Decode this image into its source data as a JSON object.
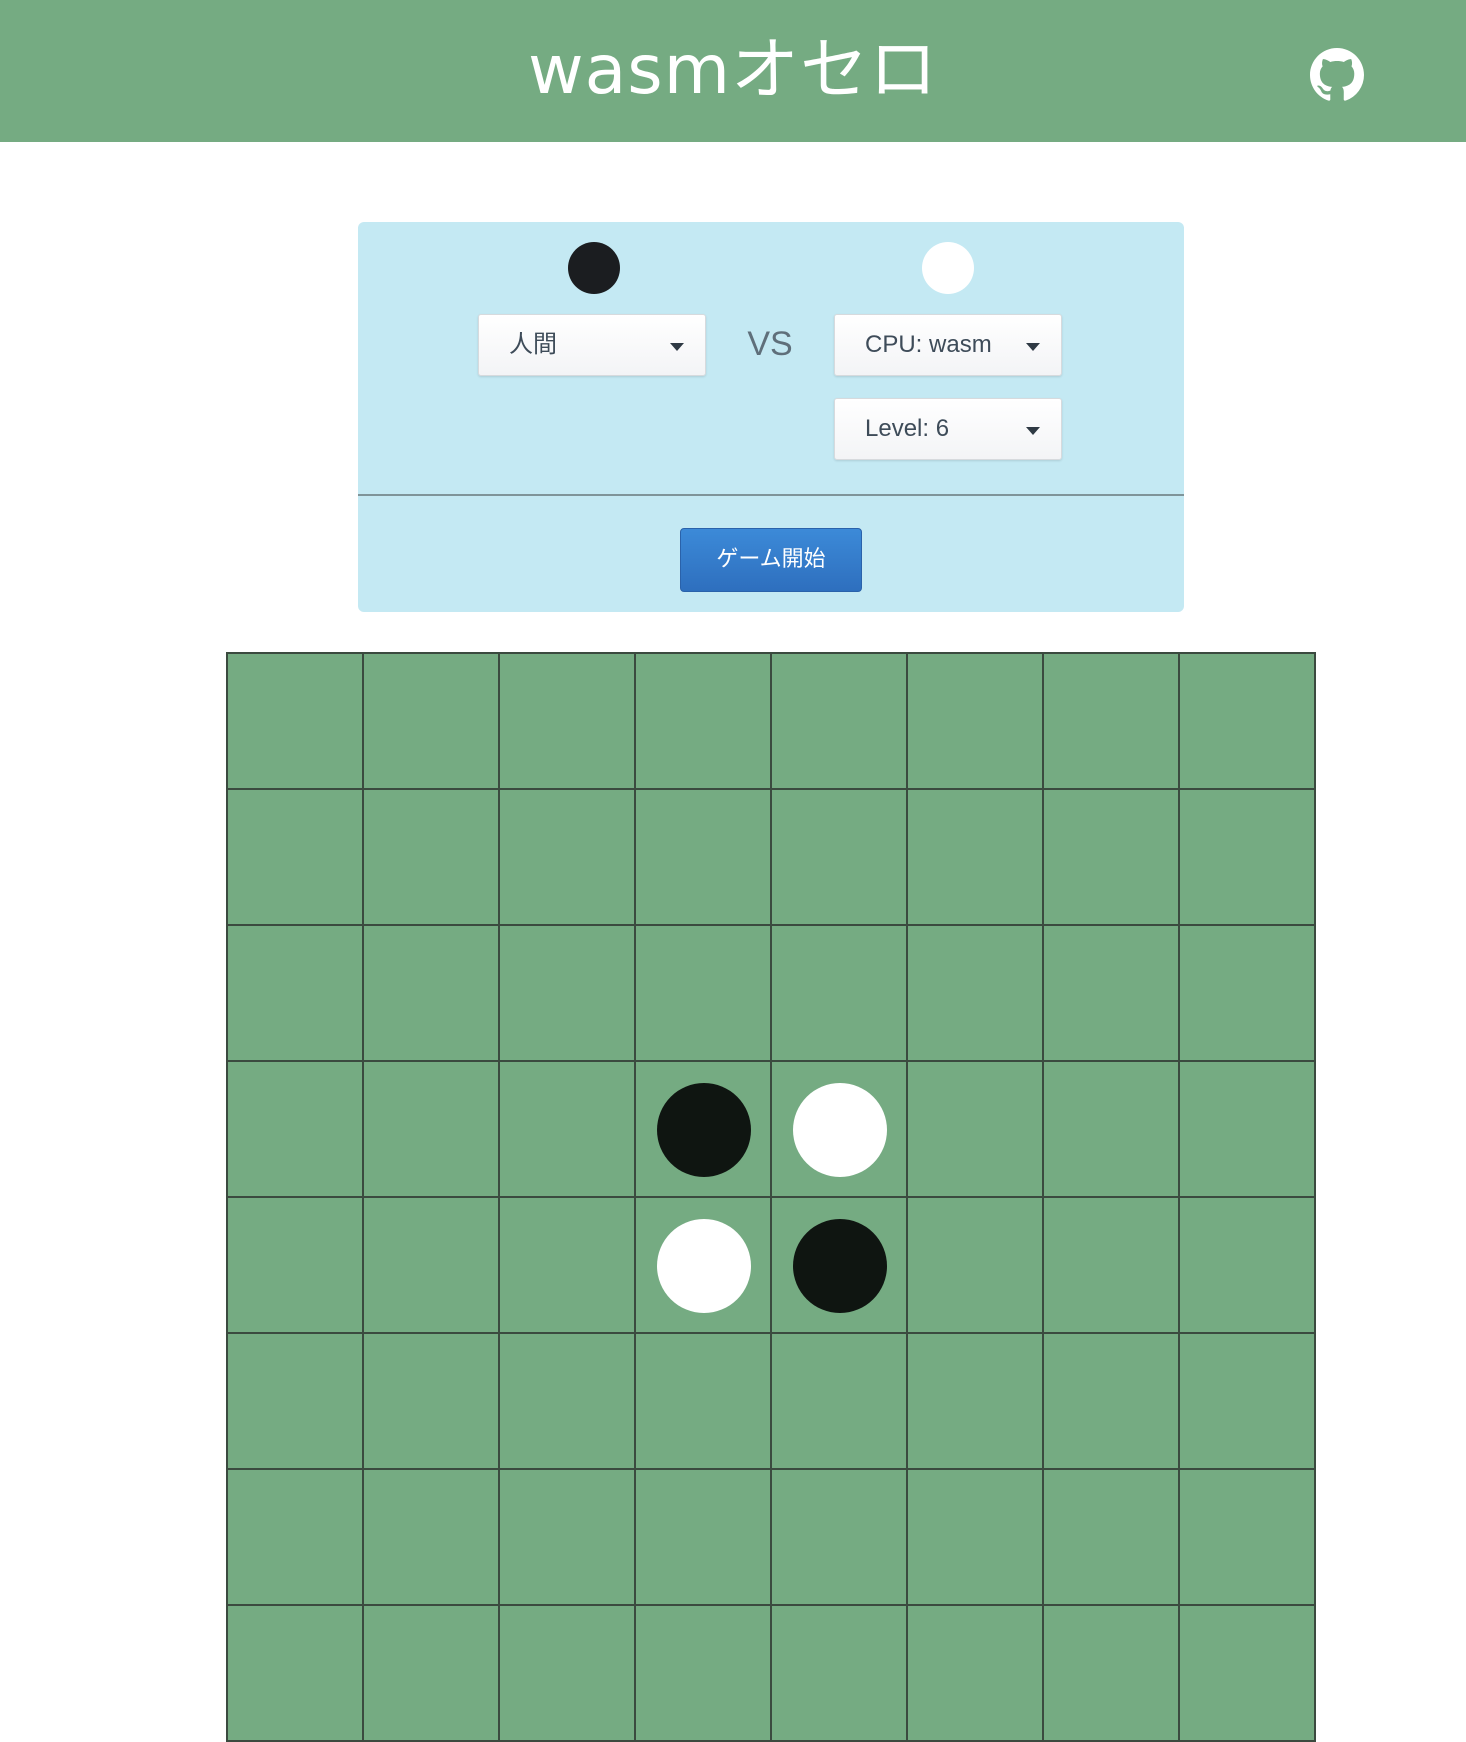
{
  "header": {
    "title": "wasmオセロ",
    "github_icon": "github-icon",
    "background_color": "#75ab82"
  },
  "settings": {
    "black_player": {
      "stone_color": "black",
      "select_value": "人間"
    },
    "vs_label": "VS",
    "white_player": {
      "stone_color": "white",
      "select_value": "CPU: wasm",
      "level_value": "Level: 6"
    },
    "start_button_label": "ゲーム開始",
    "panel_color": "#c4e9f3",
    "button_color": "#2e6fbe"
  },
  "board": {
    "size": 8,
    "board_color": "#75ab82",
    "grid": [
      [
        "",
        "",
        "",
        "",
        "",
        "",
        "",
        ""
      ],
      [
        "",
        "",
        "",
        "",
        "",
        "",
        "",
        ""
      ],
      [
        "",
        "",
        "",
        "",
        "",
        "",
        "",
        ""
      ],
      [
        "",
        "",
        "",
        "black",
        "white",
        "",
        "",
        ""
      ],
      [
        "",
        "",
        "",
        "white",
        "black",
        "",
        "",
        ""
      ],
      [
        "",
        "",
        "",
        "",
        "",
        "",
        "",
        ""
      ],
      [
        "",
        "",
        "",
        "",
        "",
        "",
        "",
        ""
      ],
      [
        "",
        "",
        "",
        "",
        "",
        "",
        "",
        ""
      ]
    ]
  }
}
